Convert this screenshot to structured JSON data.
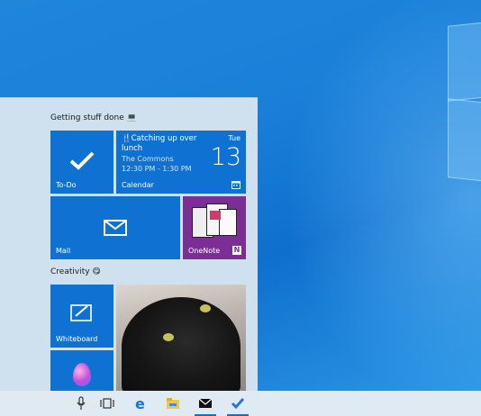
{
  "groups": [
    {
      "title": "Getting stuff done 💻"
    },
    {
      "title": "Creativity 😋"
    }
  ],
  "tiles": {
    "todo": {
      "label": "To-Do"
    },
    "calendar": {
      "label": "Calendar",
      "event_title": "🍴Catching up over lunch",
      "location": "The Commons",
      "time": "12:30 PM - 1:30 PM",
      "weekday": "Tue",
      "day": "13"
    },
    "mail": {
      "label": "Mail"
    },
    "onenote": {
      "label": "OneNote"
    },
    "whiteboard": {
      "label": "Whiteboard"
    },
    "photos": {},
    "paint3d": {}
  },
  "taskbar": {
    "icons": [
      "microphone-icon",
      "task-view-icon",
      "edge-icon",
      "file-explorer-icon",
      "mail-icon",
      "todo-icon"
    ]
  },
  "colors": {
    "accent": "#0f72d2",
    "tile_dark": "#0b5fb4",
    "start_bg": "#cfe1ee",
    "desktop": "#1a7fd8",
    "onenote": "#7b2e96"
  }
}
